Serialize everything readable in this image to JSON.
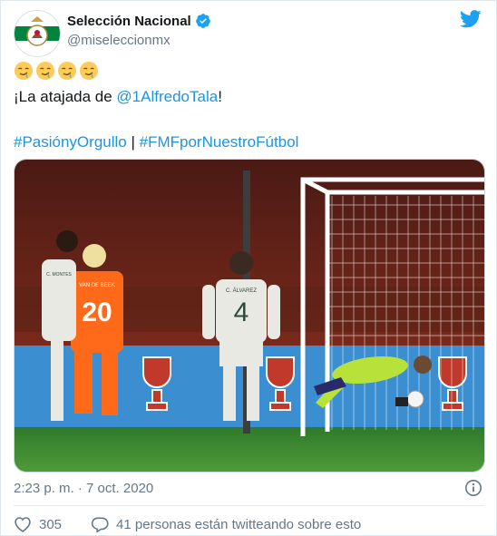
{
  "author": {
    "display_name": "Selección Nacional",
    "handle": "@miseleccionmx"
  },
  "tweet": {
    "emoji_line": "🤤🤤🤤🤤",
    "line1_prefix": "¡La atajada de ",
    "line1_mention": "@1AlfredoTala",
    "line1_suffix": "!",
    "hashtag1": "#PasiónyOrgullo",
    "separator": " | ",
    "hashtag2": "#FMFporNuestroFútbol"
  },
  "photo": {
    "jersey_orange_name": "VAN DE BEEK",
    "jersey_orange_number": "20",
    "jersey_white_name": "C. ÁLVAREZ",
    "jersey_white_number": "4",
    "jersey_white_left_name": "C. MONTES"
  },
  "meta": {
    "timestamp": "2:23 p. m. · 7 oct. 2020",
    "likes": "305",
    "conversation": "41 personas están twitteando sobre esto"
  },
  "colors": {
    "link": "#1b95e0",
    "twitter_blue": "#1da1f2",
    "like_red": "#e0245e",
    "secondary_text": "#657786"
  },
  "icons": [
    "twitter-bird-icon",
    "verified-badge-icon",
    "info-icon",
    "heart-icon",
    "comment-bubble-icon"
  ]
}
